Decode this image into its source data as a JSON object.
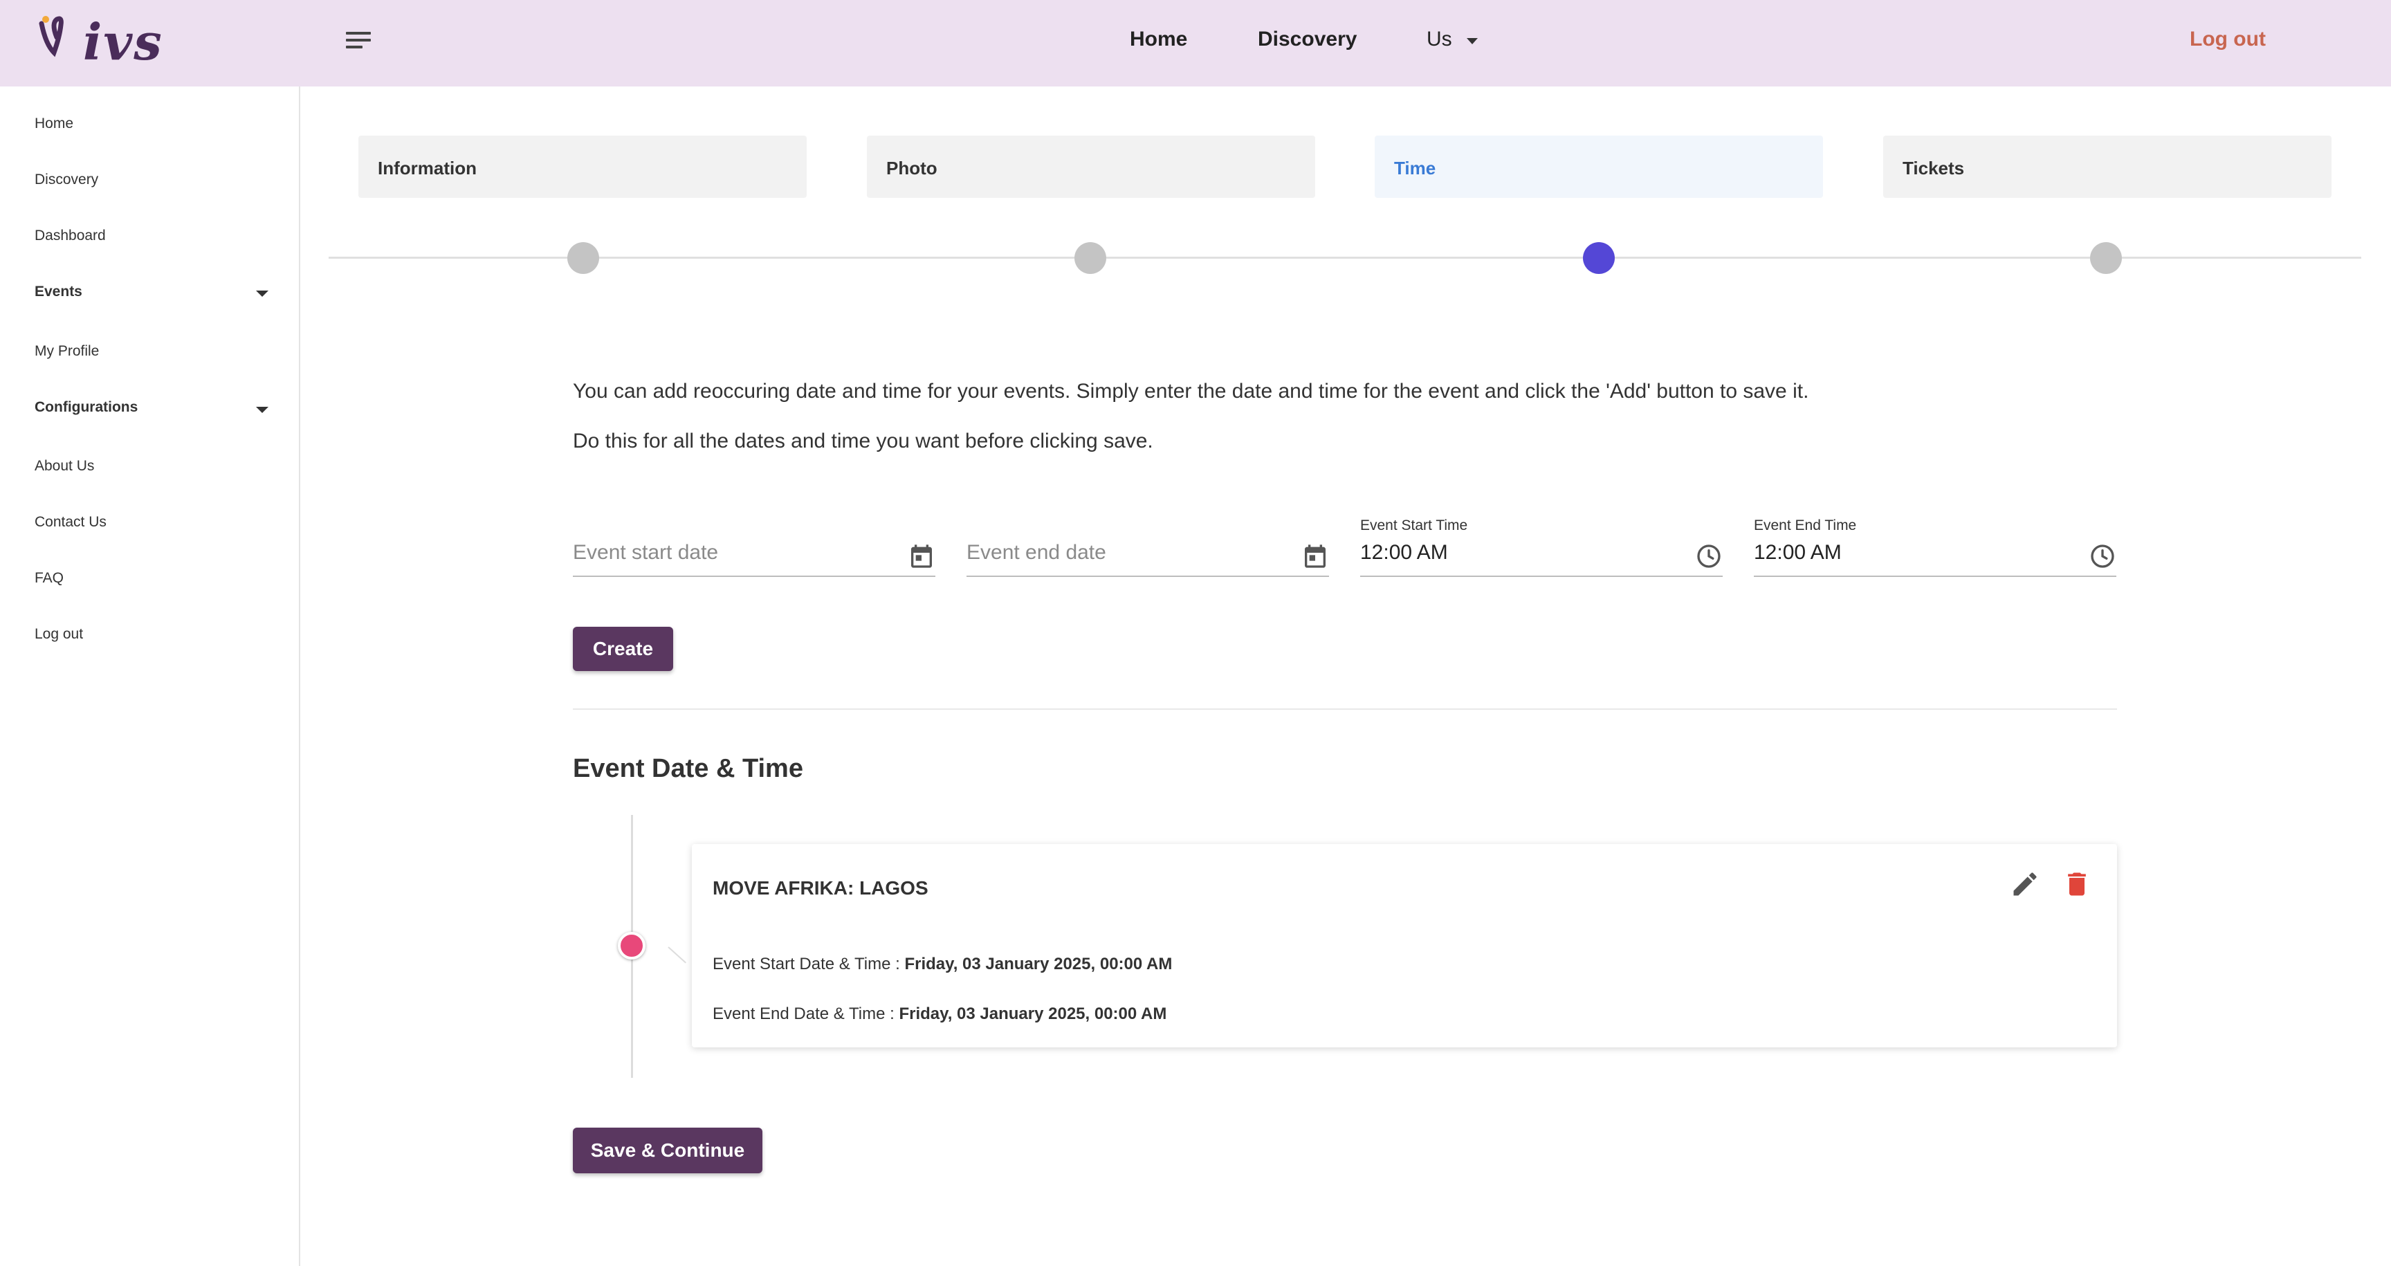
{
  "brand": {
    "logo_text": "ivs"
  },
  "topnav": {
    "home": "Home",
    "discovery": "Discovery",
    "us": "Us",
    "logout": "Log out"
  },
  "sidebar": {
    "items": [
      {
        "label": "Home"
      },
      {
        "label": "Discovery"
      },
      {
        "label": "Dashboard"
      },
      {
        "label": "Events"
      },
      {
        "label": "My Profile"
      },
      {
        "label": "Configurations"
      },
      {
        "label": "About Us"
      },
      {
        "label": "Contact Us"
      },
      {
        "label": "FAQ"
      },
      {
        "label": "Log out"
      }
    ]
  },
  "stepper": {
    "steps": [
      {
        "label": "Information"
      },
      {
        "label": "Photo"
      },
      {
        "label": "Time"
      },
      {
        "label": "Tickets"
      }
    ],
    "active_step": 3
  },
  "intro": {
    "line1": "You can add reoccuring date and time for your events. Simply enter the date and time for the event and click the 'Add' button to save it.",
    "line2": "Do this for all the dates and time you want before clicking save."
  },
  "form": {
    "start_date": {
      "placeholder": "Event start date",
      "value": ""
    },
    "end_date": {
      "placeholder": "Event end date",
      "value": ""
    },
    "start_time": {
      "label": "Event Start Time",
      "value": "12:00 AM"
    },
    "end_time": {
      "label": "Event End Time",
      "value": "12:00 AM"
    },
    "create_label": "Create"
  },
  "section": {
    "title": "Event Date & Time"
  },
  "event_card": {
    "title": "MOVE AFRIKA: LAGOS",
    "start_prefix": "Event Start Date & Time : ",
    "start_value": "Friday, 03 January 2025, 00:00 AM",
    "end_prefix": "Event End Date & Time : ",
    "end_value": "Friday, 03 January 2025, 00:00 AM"
  },
  "footer": {
    "save_label": "Save & Continue"
  },
  "colors": {
    "topbar_bg": "#ede0f0",
    "brand_purple": "#5a3760",
    "logout_orange": "#c8654f",
    "active_step_blue": "#5447d6",
    "timeline_dot": "#e8487a",
    "delete_red": "#e0453a"
  }
}
